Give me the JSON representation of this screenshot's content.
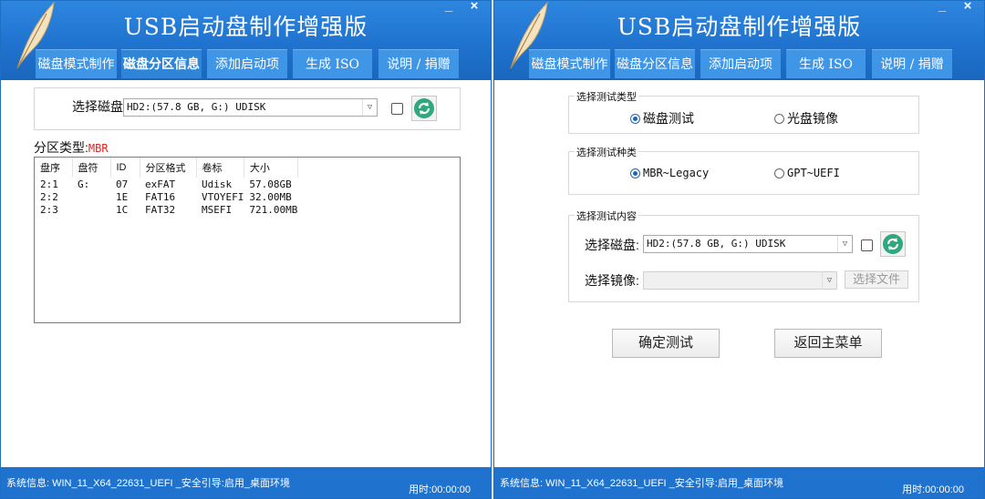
{
  "left": {
    "title": "USB启动盘制作增强版",
    "window_controls": {
      "minimize": "_",
      "close": "×"
    },
    "tabs": [
      "磁盘模式制作",
      "磁盘分区信息",
      "添加启动项",
      "生成 ISO",
      "说明 / 捐赠"
    ],
    "disk_select": {
      "label": "选择磁盘:",
      "value": "HD2:(57.8 GB, G:)  UDISK"
    },
    "partition_type": {
      "label": "分区类型:",
      "value": "MBR"
    },
    "table": {
      "columns": [
        "盘序",
        "盘符",
        "ID",
        "分区格式",
        "卷标",
        "大小"
      ],
      "rows": [
        [
          "2:1",
          "G:",
          "07",
          "exFAT",
          "Udisk",
          "57.08GB"
        ],
        [
          "2:2",
          "",
          "1E",
          "FAT16",
          "VTOYEFI",
          "32.00MB"
        ],
        [
          "2:3",
          "",
          "1C",
          "FAT32",
          "MSEFI",
          "721.00MB"
        ]
      ]
    },
    "status": {
      "info": "系统信息:  WIN_11_X64_22631_UEFI _安全引导:启用_桌面环境",
      "time": "用时:00:00:00"
    }
  },
  "right": {
    "title": "USB启动盘制作增强版",
    "window_controls": {
      "minimize": "_",
      "close": "×"
    },
    "tabs": [
      "磁盘模式制作",
      "磁盘分区信息",
      "添加启动项",
      "生成 ISO",
      "说明 / 捐赠"
    ],
    "test_type": {
      "title": "选择测试类型",
      "options": [
        "磁盘测试",
        "光盘镜像"
      ],
      "selected": 0
    },
    "test_kind": {
      "title": "选择测试种类",
      "options": [
        "MBR~Legacy",
        "GPT~UEFI"
      ],
      "selected": 0
    },
    "test_content": {
      "title": "选择测试内容",
      "disk_label": "选择磁盘:",
      "disk_value": "HD2:(57.8 GB, G:)  UDISK",
      "image_label": "选择镜像:",
      "image_value": "",
      "choose_file": "选择文件"
    },
    "buttons": {
      "confirm": "确定测试",
      "back": "返回主菜单"
    },
    "status": {
      "info": "系统信息:  WIN_11_X64_22631_UEFI _安全引导:启用_桌面环境",
      "time": "用时:00:00:00"
    }
  },
  "colors": {
    "header": "#1f73ce",
    "tab": "#3f95e6",
    "accent_red": "#e0231c",
    "refresh_green": "#2fa87d"
  }
}
